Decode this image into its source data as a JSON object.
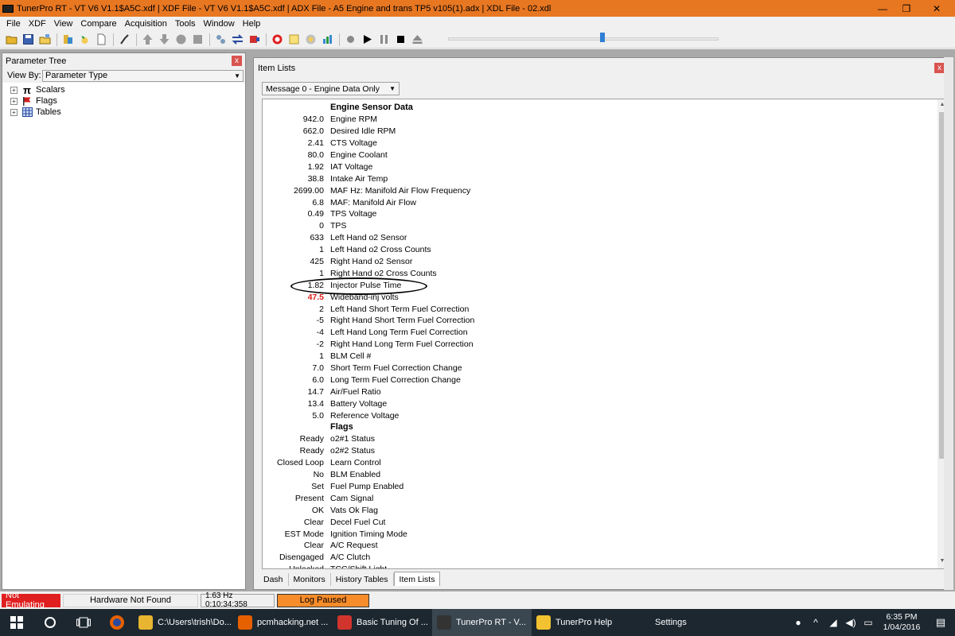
{
  "window": {
    "title": "TunerPro RT - VT V6 V1.1$A5C.xdf | XDF File - VT V6 V1.1$A5C.xdf | ADX File - A5 Engine and trans TP5 v105(1).adx | XDL File - 02.xdl",
    "minimize": "—",
    "restore": "❐",
    "close": "✕"
  },
  "menu": [
    "File",
    "XDF",
    "View",
    "Compare",
    "Acquisition",
    "Tools",
    "Window",
    "Help"
  ],
  "toolbar": {
    "icons": [
      "open-folder-icon",
      "save-icon",
      "open-file-icon",
      "load-bin-icon",
      "refresh-icon",
      "new-document-icon",
      "tune-icon",
      "arrow-up-icon",
      "arrow-down-icon",
      "circle-icon",
      "stop-icon",
      "connect-icon",
      "swap-icon",
      "emulate-icon",
      "record-icon",
      "notes-icon",
      "scan-icon",
      "chart-icon",
      "record-dot-icon",
      "play-icon",
      "pause-icon",
      "stop-square-icon",
      "eject-icon"
    ],
    "slider_value": 0.57
  },
  "parameter_tree": {
    "title": "Parameter Tree",
    "close": "x",
    "view_by_label": "View By:",
    "view_by_value": "Parameter Type",
    "items": [
      {
        "label": "Scalars",
        "icon": "pi-icon"
      },
      {
        "label": "Flags",
        "icon": "flag-icon"
      },
      {
        "label": "Tables",
        "icon": "table-icon"
      }
    ]
  },
  "item_lists": {
    "title": "Item Lists",
    "close": "x",
    "message_select": "Message 0 - Engine Data Only",
    "rows": [
      {
        "value": "",
        "name": "Engine Sensor Data",
        "section": true
      },
      {
        "value": "942.0",
        "name": "Engine RPM"
      },
      {
        "value": "662.0",
        "name": "Desired Idle RPM"
      },
      {
        "value": "2.41",
        "name": "CTS Voltage"
      },
      {
        "value": "80.0",
        "name": "Engine Coolant"
      },
      {
        "value": "1.92",
        "name": "IAT Voltage"
      },
      {
        "value": "38.8",
        "name": "Intake Air Temp"
      },
      {
        "value": "2699.00",
        "name": "MAF Hz: Manifold Air Flow Frequency"
      },
      {
        "value": "6.8",
        "name": "MAF: Manifold Air Flow"
      },
      {
        "value": "0.49",
        "name": "TPS Voltage"
      },
      {
        "value": "0",
        "name": "TPS"
      },
      {
        "value": "633",
        "name": "Left Hand o2 Sensor"
      },
      {
        "value": "1",
        "name": "Left Hand o2 Cross Counts"
      },
      {
        "value": "425",
        "name": "Right Hand o2 Sensor"
      },
      {
        "value": "1",
        "name": "Right Hand o2 Cross Counts"
      },
      {
        "value": "1.82",
        "name": "Injector Pulse Time"
      },
      {
        "value": "47.5",
        "name": "Wideband-inj volts",
        "highlight": true
      },
      {
        "value": "2",
        "name": "Left Hand Short Term Fuel Correction"
      },
      {
        "value": "-5",
        "name": "Right Hand Short Term Fuel Correction"
      },
      {
        "value": "-4",
        "name": "Left Hand Long Term Fuel Correction"
      },
      {
        "value": "-2",
        "name": "Right Hand Long Term Fuel Correction"
      },
      {
        "value": "1",
        "name": "BLM Cell #"
      },
      {
        "value": "7.0",
        "name": "Short Term Fuel Correction Change"
      },
      {
        "value": "6.0",
        "name": "Long Term Fuel Correction Change"
      },
      {
        "value": "14.7",
        "name": "Air/Fuel Ratio"
      },
      {
        "value": "13.4",
        "name": "Battery Voltage"
      },
      {
        "value": "5.0",
        "name": "Reference Voltage"
      },
      {
        "value": "",
        "name": "Flags",
        "section": true
      },
      {
        "value": "Ready",
        "name": "o2#1 Status"
      },
      {
        "value": "Ready",
        "name": "o2#2 Status"
      },
      {
        "value": "Closed Loop",
        "name": "Learn Control"
      },
      {
        "value": "No",
        "name": "BLM Enabled"
      },
      {
        "value": "Set",
        "name": "Fuel Pump Enabled"
      },
      {
        "value": "Present",
        "name": "Cam Signal"
      },
      {
        "value": "OK",
        "name": "Vats Ok Flag"
      },
      {
        "value": "Clear",
        "name": "Decel Fuel Cut"
      },
      {
        "value": "EST Mode",
        "name": "Ignition Timing Mode"
      },
      {
        "value": "Clear",
        "name": "A/C Request"
      },
      {
        "value": "Disengaged",
        "name": "A/C Clutch"
      },
      {
        "value": "Unlocked",
        "name": "TCC/Shift Light"
      }
    ],
    "tabs": [
      "Dash",
      "Monitors",
      "History Tables",
      "Item Lists"
    ],
    "active_tab": "Item Lists"
  },
  "status": {
    "emulating": "Not Emulating",
    "hardware": "Hardware Not Found",
    "rate": "1.63 Hz  0:10:34:358",
    "log": "Log Paused"
  },
  "taskbar": {
    "apps": [
      {
        "label": "C:\\Users\\trish\\Do...",
        "icon": "folder-icon",
        "color": "#e8b530"
      },
      {
        "label": "pcmhacking.net ...",
        "icon": "firefox-icon",
        "color": "#e66000"
      },
      {
        "label": "Basic Tuning Of ...",
        "icon": "pdf-icon",
        "color": "#d0342c"
      },
      {
        "label": "TunerPro RT - V...",
        "icon": "tunerpro-icon",
        "color": "#333333",
        "active": true
      },
      {
        "label": "TunerPro Help",
        "icon": "help-icon",
        "color": "#f2c230"
      },
      {
        "label": "Settings",
        "icon": "gear-icon",
        "color": "#1c2730"
      }
    ],
    "time": "6:35 PM",
    "date": "1/04/2016"
  },
  "colors": {
    "titlebar": "#e87722",
    "highlight_value": "#e0201c",
    "not_emulating": "#e02020",
    "log_paused": "#f78c2a",
    "taskbar": "#1c2730"
  }
}
